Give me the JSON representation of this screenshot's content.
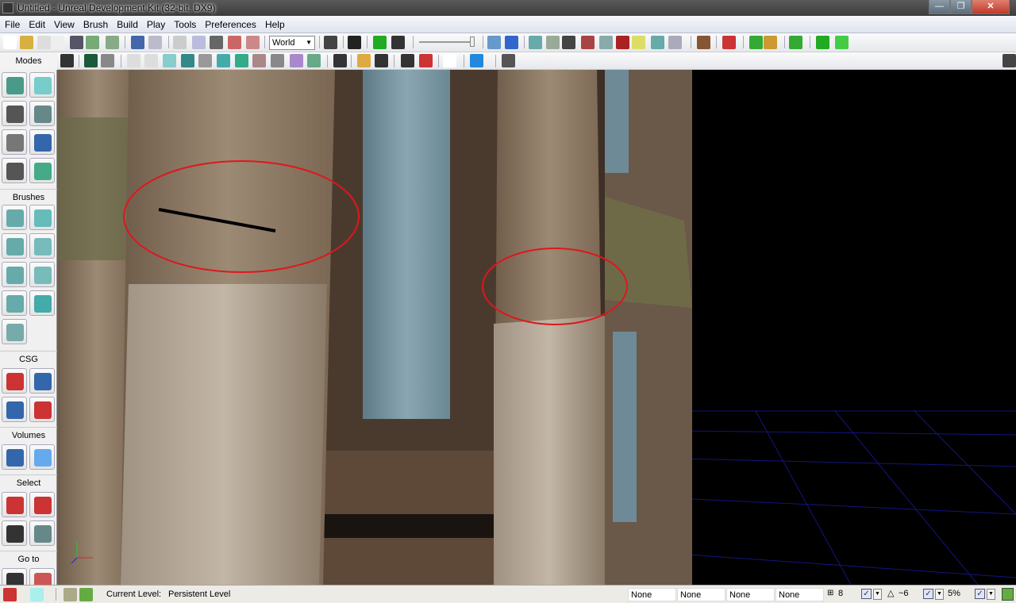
{
  "window": {
    "title": "Untitled - Unreal Development Kit (32-bit, DX9)",
    "logo": "UDK"
  },
  "menu": [
    "File",
    "Edit",
    "View",
    "Brush",
    "Build",
    "Play",
    "Tools",
    "Preferences",
    "Help"
  ],
  "toolbar": {
    "coordinate_system": "World"
  },
  "left_panel": {
    "modes_label": "Modes",
    "sections": [
      "Brushes",
      "CSG",
      "Volumes",
      "Select",
      "Go to"
    ]
  },
  "status": {
    "current_level_label": "Current Level:",
    "current_level": "Persistent Level",
    "slots": [
      "None",
      "None",
      "None",
      "None"
    ],
    "grid_size": "8",
    "rotation_snap": "~6",
    "scale_snap": "5%"
  },
  "colors": {
    "annotation": "#e0161c",
    "grid": "#1a1aa0"
  }
}
